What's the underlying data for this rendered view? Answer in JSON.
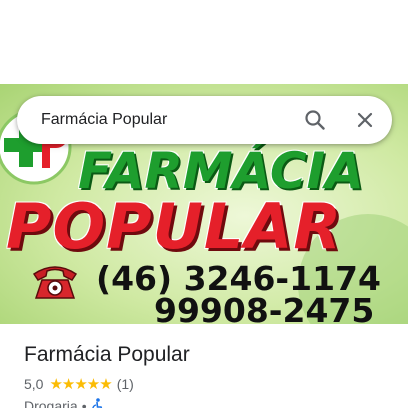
{
  "search": {
    "query": "Farmácia Popular",
    "search_icon": "search-icon",
    "close_icon": "close-icon"
  },
  "hero_image": {
    "line1": "FARMÁCIA",
    "line2": "POPULAR",
    "phone1": "(46) 3246-1174",
    "phone2": "99908-2475",
    "logo_icon": "pharmacy-logo-icon",
    "phone_icon": "telephone-icon",
    "colors": {
      "green": "#1e9e2e",
      "red": "#e5202a",
      "background": "#cfe9a2"
    }
  },
  "place": {
    "name": "Farmácia Popular",
    "rating": "5,0",
    "stars": "★★★★★",
    "review_count": "(1)",
    "category": "Drogaria",
    "separator": "•",
    "accessibility_icon": "wheelchair-icon",
    "star_color": "#fbbc04"
  }
}
